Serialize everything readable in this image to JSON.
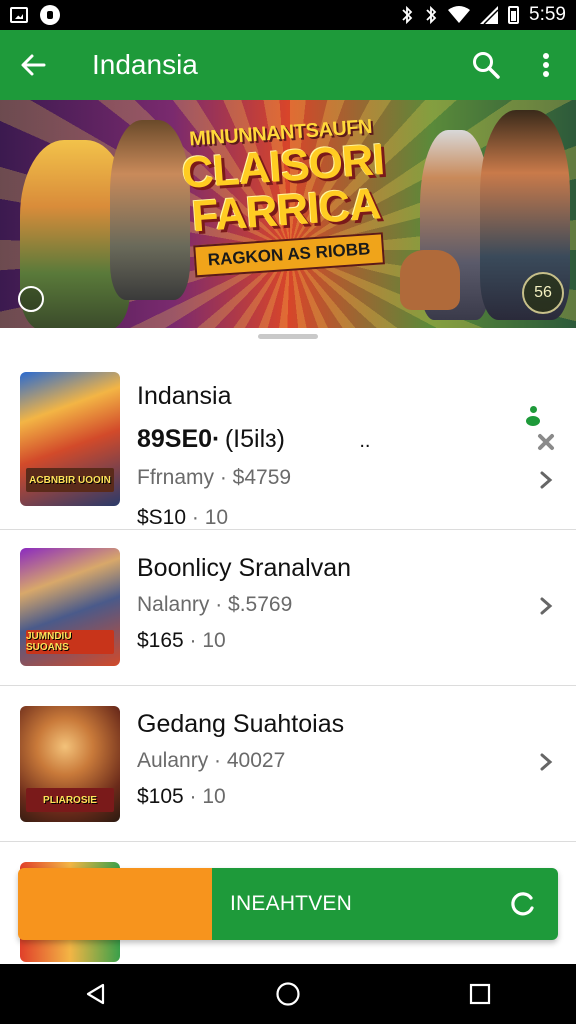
{
  "status_bar": {
    "time": "5:59",
    "left_icons": [
      "gallery-icon",
      "notification-icon"
    ],
    "right_icons": [
      "bluetooth-icon",
      "bluetooth-icon",
      "wifi-icon",
      "signal-icon",
      "battery-icon"
    ]
  },
  "app_bar": {
    "title": "Indansia",
    "back_icon": "arrow-left-icon",
    "actions": [
      "search-icon",
      "more-vert-icon"
    ],
    "color": "#1e9a3a"
  },
  "banner": {
    "logo_line1": "MINUNNANTSAUFN",
    "logo_line2": "CLAISORI",
    "logo_line3": "FARRICA",
    "logo_tagline": "RAGKON AS RIOBB",
    "badge": "56"
  },
  "items": [
    {
      "name": "Indansia",
      "price_big": "89SE0·",
      "price_paren": "(I5ilɜ)",
      "extra": "..",
      "meta": "Ffrnamy · $4759",
      "cost": "$S10",
      "cost_rest": " · 10",
      "thumb_caption": "ACBNBIR UOOIN"
    },
    {
      "name": "Boonlicy Sranalvan",
      "meta": "Nalanry · $.5769",
      "cost": "$165",
      "cost_rest": " · 10",
      "thumb_caption": "JUMNDIU SUOANS"
    },
    {
      "name": "Gedang Suahtoias",
      "meta": "Aulanry · 40027",
      "cost": "$105",
      "cost_rest": " · 10",
      "thumb_caption": "PLIAROSIE"
    }
  ],
  "action_bar": {
    "label": "INEAHTVEN",
    "left_color": "#f7941d",
    "right_color": "#1e9a3a",
    "icon": "refresh-icon"
  },
  "nav_bar": {
    "buttons": [
      "back-triangle-icon",
      "home-circle-icon",
      "recents-square-icon"
    ]
  }
}
